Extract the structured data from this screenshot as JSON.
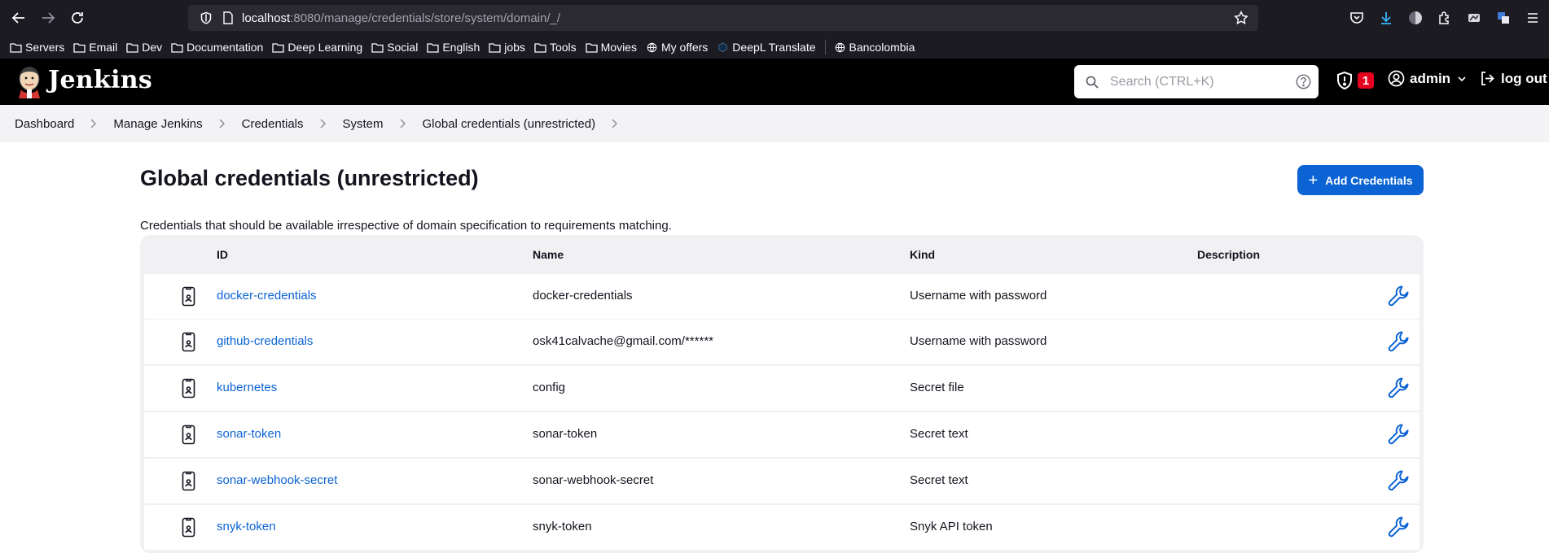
{
  "browser": {
    "url_host": "localhost",
    "url_path": ":8080/manage/credentials/store/system/domain/_/",
    "bookmarks": [
      {
        "label": "Servers",
        "icon": "folder-icon"
      },
      {
        "label": "Email",
        "icon": "folder-icon"
      },
      {
        "label": "Dev",
        "icon": "folder-icon"
      },
      {
        "label": "Documentation",
        "icon": "folder-icon"
      },
      {
        "label": "Deep Learning",
        "icon": "folder-icon"
      },
      {
        "label": "Social",
        "icon": "folder-icon"
      },
      {
        "label": "English",
        "icon": "folder-icon"
      },
      {
        "label": "jobs",
        "icon": "folder-icon"
      },
      {
        "label": "Tools",
        "icon": "folder-icon"
      },
      {
        "label": "Movies",
        "icon": "folder-icon"
      },
      {
        "label": "My offers",
        "icon": "globe-icon"
      },
      {
        "label": "DeepL Translate",
        "icon": "deepl-icon"
      },
      {
        "label": "Bancolombia",
        "icon": "globe-icon"
      }
    ]
  },
  "header": {
    "title": "Jenkins",
    "search_placeholder": "Search (CTRL+K)",
    "alert_count": "1",
    "user": "admin",
    "logout": "log out"
  },
  "breadcrumb": [
    "Dashboard",
    "Manage Jenkins",
    "Credentials",
    "System",
    "Global credentials (unrestricted)"
  ],
  "main": {
    "title": "Global credentials (unrestricted)",
    "add_button": "Add Credentials",
    "description": "Credentials that should be available irrespective of domain specification to requirements matching.",
    "columns": {
      "id": "ID",
      "name": "Name",
      "kind": "Kind",
      "description": "Description"
    },
    "rows": [
      {
        "id": "docker-credentials",
        "name": "docker-credentials",
        "kind": "Username with password",
        "description": ""
      },
      {
        "id": "github-credentials",
        "name": "osk41calvache@gmail.com/******",
        "kind": "Username with password",
        "description": ""
      },
      {
        "id": "kubernetes",
        "name": "config",
        "kind": "Secret file",
        "description": ""
      },
      {
        "id": "sonar-token",
        "name": "sonar-token",
        "kind": "Secret text",
        "description": ""
      },
      {
        "id": "sonar-webhook-secret",
        "name": "sonar-webhook-secret",
        "kind": "Secret text",
        "description": ""
      },
      {
        "id": "snyk-token",
        "name": "snyk-token",
        "kind": "Snyk API token",
        "description": ""
      }
    ]
  },
  "colors": {
    "accent": "#0b63d4",
    "header_bg": "#000000",
    "badge": "#e6001f"
  }
}
